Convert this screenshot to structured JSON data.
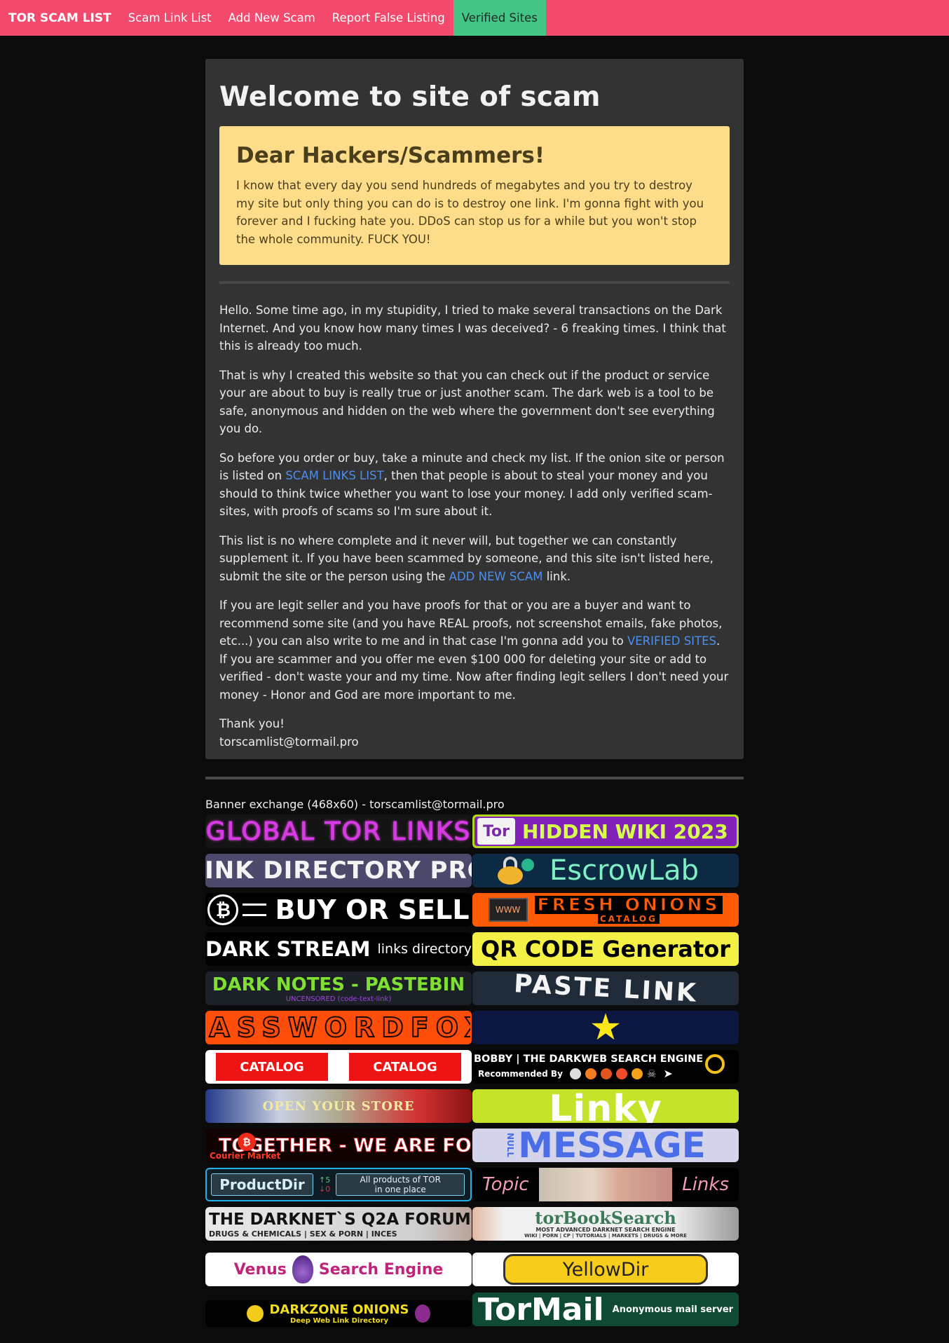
{
  "navbar": {
    "brand": "TOR SCAM LIST",
    "items": [
      "Scam Link List",
      "Add New Scam",
      "Report False Listing",
      "Verified Sites"
    ]
  },
  "main": {
    "title": "Welcome to site of scam",
    "alert": {
      "heading": "Dear Hackers/Scammers!",
      "text": "I know that every day you send hundreds of megabytes and you try to destroy my site but only thing you can do is to destroy one link. I'm gonna fight with you forever and I fucking hate you. DDoS can stop us for a while but you won't stop the whole community. FUCK YOU!"
    },
    "p1": "Hello. Some time ago, in my stupidity, I tried to make several transactions on the Dark Internet. And you know how many times I was deceived? - 6 freaking times. I think that this is already too much.",
    "p2": "That is why I created this website so that you can check out if the product or service your are about to buy is really true or just another scam. The dark web is a tool to be safe, anonymous and hidden on the web where the government don't see everything you do.",
    "p3a": "So before you order or buy, take a minute and check my list. If the onion site or person is listed on ",
    "p3link": "SCAM LINKS LIST",
    "p3b": ", then that people is about to steal your money and you should to think twice whether you want to lose your money. I add only verified scam-sites, with proofs of scams so I'm sure about it.",
    "p4a": "This list is no where complete and it never will, but together we can constantly supplement it. If you have been scammed by someone, and this site isn't listed here, submit the site or the person using the ",
    "p4link": "ADD NEW SCAM",
    "p4b": " link.",
    "p5a": "If you are legit seller and you have proofs for that or you are a buyer and want to recommend some site (and you have REAL proofs, not screenshot emails, fake photos, etc...) you can also write to me and in that case I'm gonna add you to ",
    "p5link": "VERIFIED SITES",
    "p5b": ". If you are scammer and you offer me even $100 000 for deleting your site or add to verified - don't waste your and my time. Now after finding legit sellers I don't need your money - Honor and God are more important to me.",
    "thanks": "Thank you!",
    "email": "torscamlist@tormail.pro"
  },
  "banners": {
    "title": "Banner exchange (468x60) - torscamlist@tormail.pro",
    "b1": "GLOBAL TOR LINKS",
    "b2a": "Tor",
    "b2b": "HIDDEN WIKI 2023",
    "b3": "LINK DIRECTORY PRO",
    "b4": "EscrowLab",
    "b5": "BUY OR SELL",
    "b6a": "FRESH ONIONS",
    "b6b": "CATALOG",
    "b6c": "WWW",
    "b7a": "DARK STREAM",
    "b7b": "links directory",
    "b8": "QR CODE Generator",
    "b9a": "DARK NOTES - PASTEBIN",
    "b9b": "UNCENSORED (code-text-link)",
    "b10": "PASTE LINK",
    "b11": "PASSWORDFOX",
    "b13": "CATALOG",
    "b14a": "BOBBY | THE DARKWEB SEARCH ENGINE",
    "b14b": "Recommended By",
    "b15": "OPEN YOUR STORE",
    "b16": "Linky",
    "b17a": "TOGETHER - WE ARE FORCE!",
    "b17b": "Courier Market",
    "b18a": "NULL",
    "b18b": "MESSAGE",
    "b19a": "ProductDir",
    "b19b": "5",
    "b19c": "0",
    "b19d": "All products of TOR",
    "b19e": "in one place",
    "b20a": "Topic",
    "b20b": "Links",
    "b21a": "THE DARKNET`S Q2A FORUM",
    "b21b": "DRUGS & CHEMICALS | SEX & PORN | INCES",
    "b22a": "torBookSearch",
    "b22b": "MOST ADVANCED DARKNET SEARCH ENGINE",
    "b22c": "WIKI | PORN | CP | TUTORIALS | MARKETS | DRUGS & MORE",
    "b23a": "Venus",
    "b23b": "Search Engine",
    "b24": "YellowDir",
    "b25a": "DARKZONE ONIONS",
    "b25b": "Deep Web Link Directory",
    "b26a": "TorMail",
    "b26b": "Anonymous mail server"
  }
}
